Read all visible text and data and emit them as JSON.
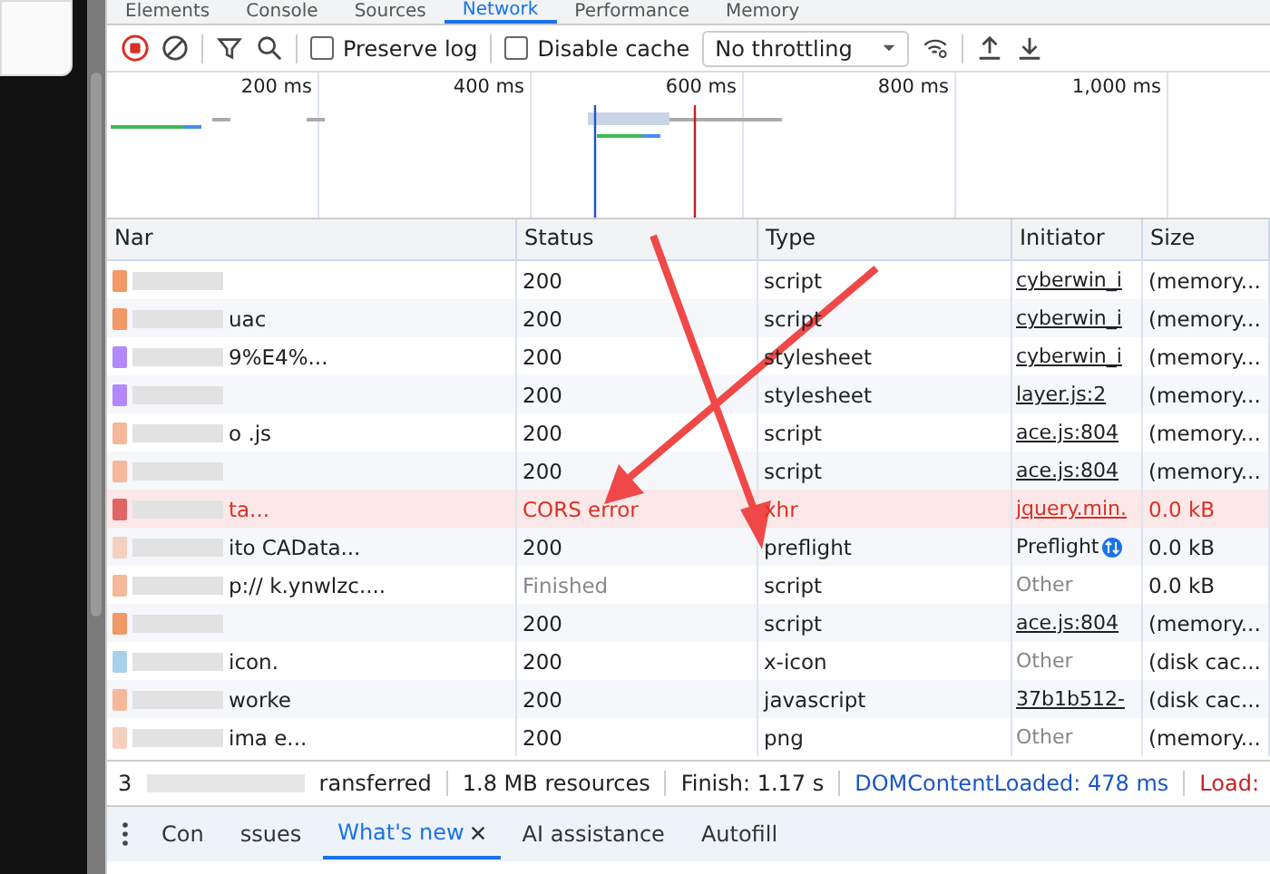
{
  "panel_tabs": [
    {
      "label": "Elements",
      "selected": false
    },
    {
      "label": "Console",
      "selected": false
    },
    {
      "label": "Sources",
      "selected": false
    },
    {
      "label": "Network",
      "selected": true
    },
    {
      "label": "Performance",
      "selected": false
    },
    {
      "label": "Memory",
      "selected": false
    }
  ],
  "toolbar": {
    "preserve_log": {
      "label": "Preserve log",
      "checked": false
    },
    "disable_cache": {
      "label": "Disable cache",
      "checked": false
    },
    "throttling": "No throttling"
  },
  "overview": {
    "ticks": [
      "200 ms",
      "400 ms",
      "600 ms",
      "800 ms",
      "1,000 ms"
    ]
  },
  "table": {
    "columns": [
      "Nar",
      "Status",
      "Type",
      "Initiator",
      "Size"
    ],
    "rows": [
      {
        "name": null,
        "color": "#f29766",
        "kind": "normal",
        "status": "200",
        "type": "script",
        "initiator": "cyberwin_i",
        "initiator_link": true,
        "initiator_muted": false,
        "size": "(memory..."
      },
      {
        "name": "uac",
        "color": "#f29766",
        "kind": "normal",
        "status": "200",
        "type": "script",
        "initiator": "cyberwin_i",
        "initiator_link": true,
        "initiator_muted": false,
        "size": "(memory..."
      },
      {
        "name": "9%E4%...",
        "color": "#b388ff",
        "kind": "normal",
        "status": "200",
        "type": "stylesheet",
        "initiator": "cyberwin_i",
        "initiator_link": true,
        "initiator_muted": false,
        "size": "(memory..."
      },
      {
        "name": null,
        "color": "#b388ff",
        "kind": "normal",
        "status": "200",
        "type": "stylesheet",
        "initiator": "layer.js:2",
        "initiator_link": true,
        "initiator_muted": false,
        "size": "(memory..."
      },
      {
        "name": "o .js",
        "color": "#f5b89a",
        "kind": "normal",
        "status": "200",
        "type": "script",
        "initiator": "ace.js:804",
        "initiator_link": true,
        "initiator_muted": false,
        "size": "(memory..."
      },
      {
        "name": null,
        "color": "#f5b89a",
        "kind": "normal",
        "status": "200",
        "type": "script",
        "initiator": "ace.js:804",
        "initiator_link": true,
        "initiator_muted": false,
        "size": "(memory..."
      },
      {
        "name": "ta...",
        "color": "#e06666",
        "kind": "error",
        "status": "CORS error",
        "type": "xhr",
        "initiator": "jquery.min.",
        "initiator_link": true,
        "initiator_muted": false,
        "size": "0.0 kB"
      },
      {
        "name": "ito CAData...",
        "color": "#f5d0c0",
        "kind": "normal",
        "status": "200",
        "type": "preflight",
        "initiator": "Preflight",
        "initiator_link": false,
        "initiator_muted": false,
        "size": "0.0 kB"
      },
      {
        "name": "p:// k.ynwlzc....",
        "color": "#f5b89a",
        "kind": "pending",
        "status": "Finished",
        "type": "script",
        "initiator": "Other",
        "initiator_link": false,
        "initiator_muted": true,
        "size": "0.0 kB"
      },
      {
        "name": null,
        "color": "#f29766",
        "kind": "normal",
        "status": "200",
        "type": "script",
        "initiator": "ace.js:804",
        "initiator_link": true,
        "initiator_muted": false,
        "size": "(memory..."
      },
      {
        "name": "icon.",
        "color": "#a8d0ec",
        "kind": "normal",
        "status": "200",
        "type": "x-icon",
        "initiator": "Other",
        "initiator_link": false,
        "initiator_muted": true,
        "size": "(disk cac..."
      },
      {
        "name": "worke",
        "color": "#f5b89a",
        "kind": "normal",
        "status": "200",
        "type": "javascript",
        "initiator": "37b1b512-",
        "initiator_link": true,
        "initiator_muted": false,
        "size": "(disk cac..."
      },
      {
        "name": "ima e...",
        "color": "#f5d0c0",
        "kind": "normal",
        "status": "200",
        "type": "png",
        "initiator": "Other",
        "initiator_link": false,
        "initiator_muted": true,
        "size": "(memory..."
      }
    ]
  },
  "summary": [
    {
      "text": "3",
      "kind": "plain"
    },
    {
      "text": "ransferred",
      "kind": "plain"
    },
    {
      "text": "1.8 MB resources",
      "kind": "plain"
    },
    {
      "text": "Finish: 1.17 s",
      "kind": "plain"
    },
    {
      "text": "DOMContentLoaded: 478 ms",
      "kind": "dom"
    },
    {
      "text": "Load:",
      "kind": "load"
    }
  ],
  "drawer_tabs": [
    {
      "label": "Con",
      "selected": false,
      "closable": false
    },
    {
      "label": "ssues",
      "selected": false,
      "closable": false
    },
    {
      "label": "What's new",
      "selected": true,
      "closable": true
    },
    {
      "label": "AI assistance",
      "selected": false,
      "closable": false
    },
    {
      "label": "Autofill",
      "selected": false,
      "closable": false
    }
  ]
}
